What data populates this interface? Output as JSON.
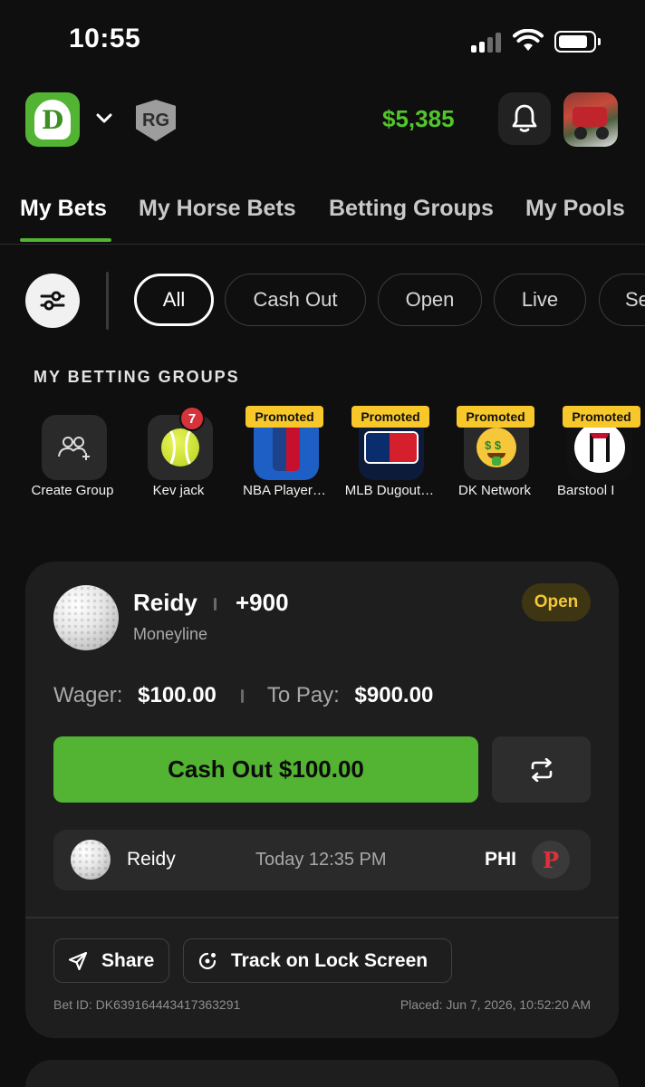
{
  "status_bar": {
    "time": "10:55",
    "battery_level": 0.85
  },
  "header": {
    "logo_letter": "D",
    "rg_label": "RG",
    "balance": "$5,385",
    "colors": {
      "brand_green": "#53b332",
      "balance_green": "#53c52c"
    }
  },
  "tabs": [
    {
      "label": "My Bets",
      "active": true
    },
    {
      "label": "My Horse Bets",
      "active": false
    },
    {
      "label": "Betting Groups",
      "active": false
    },
    {
      "label": "My Pools",
      "active": false
    }
  ],
  "filters": [
    {
      "label": "All",
      "active": true
    },
    {
      "label": "Cash Out",
      "active": false
    },
    {
      "label": "Open",
      "active": false
    },
    {
      "label": "Live",
      "active": false
    },
    {
      "label": "Se",
      "active": false
    }
  ],
  "groups": {
    "title": "MY BETTING GROUPS",
    "items": [
      {
        "label": "Create Group",
        "icon": "add-users-icon"
      },
      {
        "label": "Kev jack",
        "icon": "tennis-ball-icon",
        "badge": "7"
      },
      {
        "label": "NBA Player…",
        "icon": "nba-logo-icon",
        "promo": "Promoted"
      },
      {
        "label": "MLB Dugout…",
        "icon": "mlb-logo-icon",
        "promo": "Promoted"
      },
      {
        "label": "DK Network",
        "icon": "money-face-icon",
        "promo": "Promoted"
      },
      {
        "label": "Barstool I",
        "icon": "barstool-logo-icon",
        "promo": "Promoted"
      }
    ]
  },
  "bet": {
    "selection": "Reidy",
    "odds": "+900",
    "market": "Moneyline",
    "status": "Open",
    "wager_label": "Wager:",
    "wager": "$100.00",
    "to_pay_label": "To Pay:",
    "to_pay": "$900.00",
    "cashout_label": "Cash Out $100.00",
    "leg": {
      "name": "Reidy",
      "time": "Today 12:35 PM",
      "team": "PHI",
      "team_logo_letter": "P"
    },
    "share_label": "Share",
    "track_label": "Track on Lock Screen",
    "bet_id": "Bet ID: DK639164443417363291",
    "placed": "Placed: Jun 7, 2026, 10:52:20 AM"
  }
}
